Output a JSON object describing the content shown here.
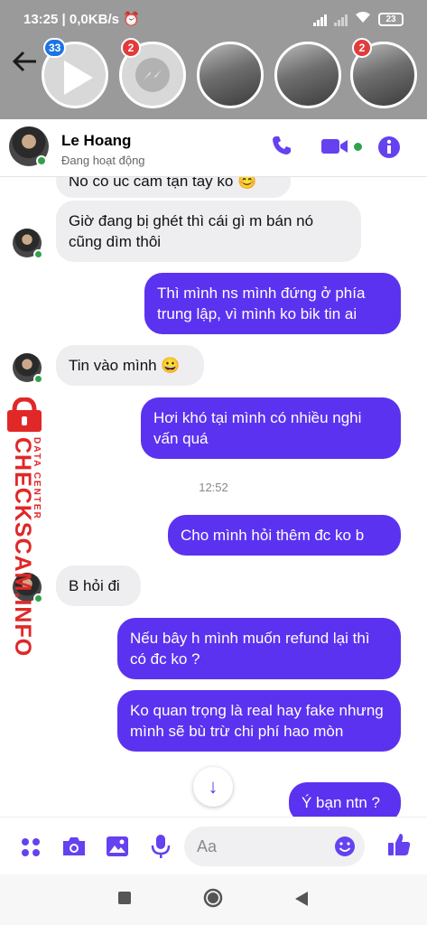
{
  "status_bar": {
    "time": "13:25",
    "network_speed": "0,0KB/s",
    "battery": "23"
  },
  "chat_heads": [
    {
      "name": "video-chat-head",
      "badge": "33"
    },
    {
      "name": "messenger-chat-head",
      "badge": "2"
    },
    {
      "name": "contact-chat-head-1",
      "badge": ""
    },
    {
      "name": "contact-chat-head-2",
      "badge": ""
    },
    {
      "name": "le-hoang-chat-head",
      "badge": ""
    },
    {
      "name": "contact-chat-head-3",
      "badge": "2"
    }
  ],
  "header": {
    "name": "Le Hoang",
    "status": "Đang hoạt động"
  },
  "messages": [
    {
      "direction": "in",
      "text": "Nó có úc cám tận tay ko 😊"
    },
    {
      "direction": "in",
      "text": "Giờ đang bị ghét thì cái gì m bán nó cũng dìm thôi"
    },
    {
      "direction": "out",
      "text": "Thì mình ns mình đứng ở phía trung lập, vì mình ko bik tin ai"
    },
    {
      "direction": "in",
      "text": "Tin vào mình 😀"
    },
    {
      "direction": "out",
      "text": "Hơi khó tại mình có nhiều nghi vấn quá"
    },
    {
      "direction": "out",
      "text": "Cho mình hỏi thêm đc ko b"
    },
    {
      "direction": "in",
      "text": "B hỏi đi"
    },
    {
      "direction": "out",
      "text": "Nếu bây h mình muốn refund lại thì có đc ko ?"
    },
    {
      "direction": "out",
      "text": "Ko quan trọng là real hay fake nhưng mình sẽ bù trừ chi phí hao mòn"
    },
    {
      "direction": "out",
      "text": "Ý bạn ntn ?"
    }
  ],
  "timestamp": "12:52",
  "watermark": {
    "main": "CHECKSCAM.INFO",
    "sub": "DATA CENTER"
  },
  "composer": {
    "placeholder": "Aa"
  },
  "colors": {
    "accent": "#6541f0",
    "outgoing_bubble": "#5b32f0",
    "incoming_bubble": "#eeeef0",
    "online": "#31a24c",
    "badge_blue": "#1b74e4",
    "badge_red": "#e23b3b",
    "watermark": "#e02828"
  }
}
